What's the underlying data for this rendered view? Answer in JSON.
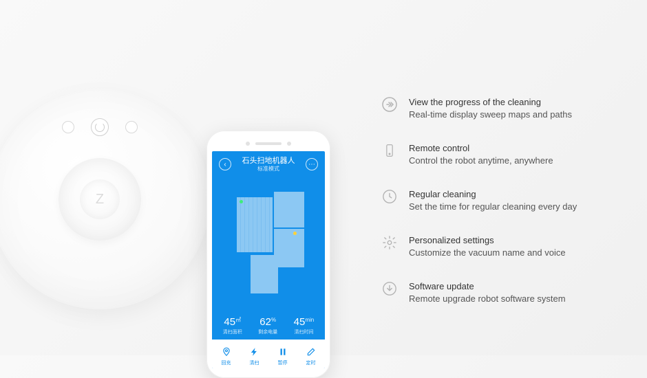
{
  "phone": {
    "header_title": "石头扫地机器人",
    "header_subtitle": "标准模式",
    "stats": [
      {
        "value": "45",
        "unit": "㎡",
        "label": "清扫面积"
      },
      {
        "value": "62",
        "unit": "%",
        "label": "剩余电量"
      },
      {
        "value": "45",
        "unit": "min",
        "label": "清扫时间"
      }
    ],
    "nav": [
      {
        "label": "回充"
      },
      {
        "label": "清扫"
      },
      {
        "label": "暂停"
      },
      {
        "label": "定时"
      }
    ]
  },
  "features": [
    {
      "icon": "progress-icon",
      "title": "View the progress of the cleaning",
      "desc": "Real-time display sweep maps and paths"
    },
    {
      "icon": "remote-icon",
      "title": "Remote control",
      "desc": "Control  the robot anytime, anywhere"
    },
    {
      "icon": "clock-icon",
      "title": "Regular cleaning",
      "desc": "Set the time for regular cleaning every day"
    },
    {
      "icon": "settings-icon",
      "title": "Personalized settings",
      "desc": "Customize the vacuum name and voice"
    },
    {
      "icon": "download-icon",
      "title": "Software update",
      "desc": "Remote upgrade robot software system"
    }
  ]
}
